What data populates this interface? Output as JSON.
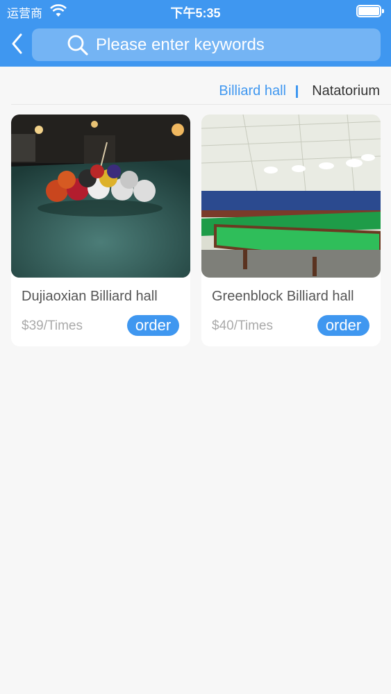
{
  "status_bar": {
    "carrier": "运营商",
    "time": "下午5:35"
  },
  "search": {
    "placeholder": "Please enter keywords"
  },
  "tabs": [
    {
      "label": "Billiard hall",
      "active": true
    },
    {
      "label": "Natatorium",
      "active": false
    }
  ],
  "venues": [
    {
      "name": "Dujiaoxian Billiard hall",
      "price": "$39/Times",
      "order_label": "order"
    },
    {
      "name": "Greenblock Billiard hall",
      "price": "$40/Times",
      "order_label": "order"
    }
  ],
  "colors": {
    "accent": "#3f97f0",
    "background": "#f7f7f7"
  }
}
